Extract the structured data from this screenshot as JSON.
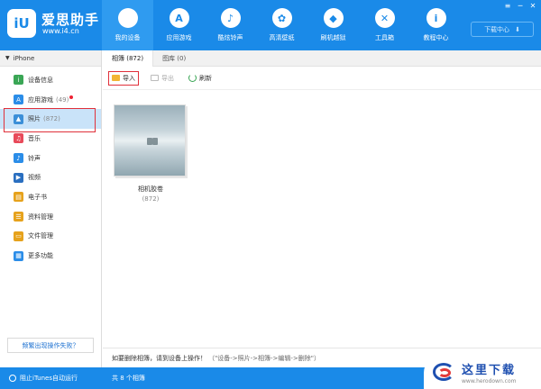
{
  "header": {
    "brand_name": "爱思助手",
    "brand_url": "www.i4.cn",
    "logo_text": "iU",
    "nav": [
      {
        "label": "我的设备",
        "icon": "apple-icon",
        "glyph": "",
        "active": true
      },
      {
        "label": "应用游戏",
        "icon": "appstore-icon",
        "glyph": "A",
        "active": false
      },
      {
        "label": "酷炫铃声",
        "icon": "bell-icon",
        "glyph": "♪",
        "active": false
      },
      {
        "label": "高清壁纸",
        "icon": "flower-icon",
        "glyph": "✿",
        "active": false
      },
      {
        "label": "刷机越狱",
        "icon": "dropbox-icon",
        "glyph": "◆",
        "active": false
      },
      {
        "label": "工具箱",
        "icon": "tools-icon",
        "glyph": "✕",
        "active": false
      },
      {
        "label": "教程中心",
        "icon": "info-icon",
        "glyph": "i",
        "active": false
      }
    ],
    "download_center": "下载中心",
    "window_controls": [
      "≡",
      "─",
      "✕"
    ]
  },
  "sidebar": {
    "device": "iPhone",
    "items": [
      {
        "label": "设备信息",
        "count": "",
        "icon": "info-circle-icon",
        "color": "#3aa655",
        "glyph": "i"
      },
      {
        "label": "应用游戏",
        "count": "(49)",
        "icon": "appstore-icon",
        "color": "#2b8de8",
        "glyph": "A",
        "dot": true
      },
      {
        "label": "照片",
        "count": "(872)",
        "icon": "photo-icon",
        "color": "#3b8fd8",
        "glyph": "▲",
        "active": true
      },
      {
        "label": "音乐",
        "count": "",
        "icon": "music-icon",
        "color": "#e84a5a",
        "glyph": "♫"
      },
      {
        "label": "铃声",
        "count": "",
        "icon": "bell-icon",
        "color": "#2b8de8",
        "glyph": "♪"
      },
      {
        "label": "视频",
        "count": "",
        "icon": "video-icon",
        "color": "#2a6fc0",
        "glyph": "▶"
      },
      {
        "label": "电子书",
        "count": "",
        "icon": "book-icon",
        "color": "#e6a21c",
        "glyph": "▤"
      },
      {
        "label": "资料管理",
        "count": "",
        "icon": "contacts-icon",
        "color": "#e6a21c",
        "glyph": "☰"
      },
      {
        "label": "文件管理",
        "count": "",
        "icon": "folder-icon",
        "color": "#e6a21c",
        "glyph": "▭"
      },
      {
        "label": "更多功能",
        "count": "",
        "icon": "grid-icon",
        "color": "#2b8de8",
        "glyph": "▦"
      }
    ],
    "help_button": "频繁出现操作失败？"
  },
  "main": {
    "tabs": [
      {
        "label": "相簿 (872)",
        "active": true
      },
      {
        "label": "图库 (0)",
        "active": false
      }
    ],
    "toolbar": {
      "import": "导入",
      "export": "导出",
      "refresh": "刷新"
    },
    "album": {
      "name": "相机胶卷",
      "count": "(872)"
    },
    "hint_text": "如要删除相簿，请到设备上操作！",
    "hint_path": "（\"设备->照片->相簿->编辑->删除\"）"
  },
  "status": {
    "itunes": "阻止iTunes自动运行",
    "album_total": "共 8 个相簿"
  },
  "watermark": {
    "cn": "这里下载",
    "url": "www.herodown.com"
  }
}
